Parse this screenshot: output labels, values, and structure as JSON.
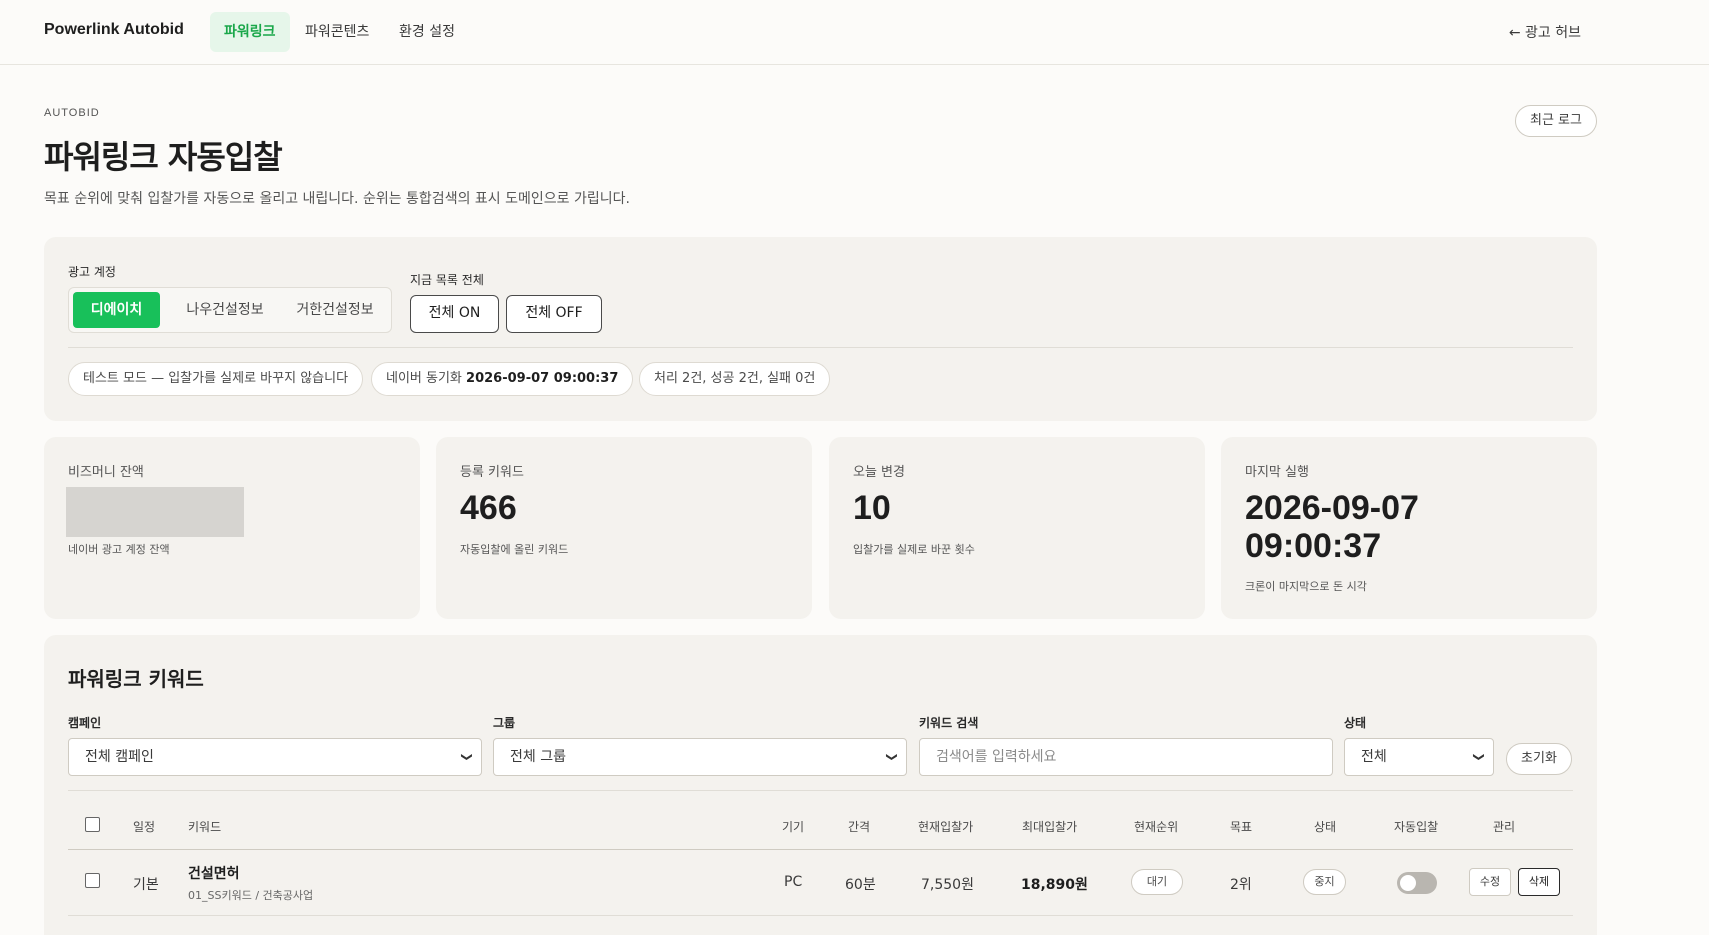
{
  "nav": {
    "brand": "Powerlink Autobid",
    "tabs": [
      {
        "label": "파워링크",
        "active": true
      },
      {
        "label": "파워콘텐츠",
        "active": false
      },
      {
        "label": "환경 설정",
        "active": false
      }
    ],
    "hub_link": "← 광고 허브"
  },
  "header": {
    "eyebrow": "AUTOBID",
    "title": "파워링크 자동입찰",
    "subtitle": "목표 순위에 맞춰 입찰가를 자동으로 올리고 내립니다. 순위는 통합검색의 표시 도메인으로 가립니다.",
    "recent_log_button": "최근 로그"
  },
  "account_panel": {
    "account_label": "광고 계정",
    "accounts": [
      {
        "label": "디에이치",
        "active": true
      },
      {
        "label": "나우건설정보",
        "active": false
      },
      {
        "label": "거한건설정보",
        "active": false
      }
    ],
    "bulk_label": "지금 목록 전체",
    "bulk_on": "전체 ON",
    "bulk_off": "전체 OFF",
    "chips": {
      "test_mode": "테스트 모드 — 입찰가를 실제로 바꾸지 않습니다",
      "sync_prefix": "네이버 동기화",
      "sync_time": "2026-09-07 09:00:37",
      "result": "처리 2건, 성공 2건, 실패 0건"
    }
  },
  "stats": [
    {
      "label": "비즈머니 잔액",
      "value": "",
      "sub": "네이버 광고 계정 잔액"
    },
    {
      "label": "등록 키워드",
      "value": "466",
      "sub": "자동입찰에 올린 키워드"
    },
    {
      "label": "오늘 변경",
      "value": "10",
      "sub": "입찰가를 실제로 바꾼 횟수"
    },
    {
      "label": "마지막 실행",
      "value_line1": "2026-09-07",
      "value_line2": "09:00:37",
      "sub": "크론이 마지막으로 돈 시각"
    }
  ],
  "keywords": {
    "title": "파워링크 키워드",
    "filters": {
      "campaign_label": "캠페인",
      "campaign_value": "전체 캠페인",
      "group_label": "그룹",
      "group_value": "전체 그룹",
      "search_label": "키워드 검색",
      "search_placeholder": "검색어를 입력하세요",
      "status_label": "상태",
      "status_value": "전체",
      "reset_button": "초기화"
    },
    "columns": [
      "일정",
      "키워드",
      "기기",
      "간격",
      "현재입찰가",
      "최대입찰가",
      "현재순위",
      "목표",
      "상태",
      "자동입찰",
      "관리"
    ],
    "rows": [
      {
        "schedule": "기본",
        "keyword": "건설면허",
        "path": "01_SS키워드 / 건축공사업",
        "device": "PC",
        "interval": "60분",
        "current_bid": "7,550원",
        "max_bid": "18,890원",
        "current_rank": "대기",
        "target": "2위",
        "status": "중지",
        "autobid_on": false,
        "edit": "수정",
        "delete": "삭제"
      }
    ]
  }
}
